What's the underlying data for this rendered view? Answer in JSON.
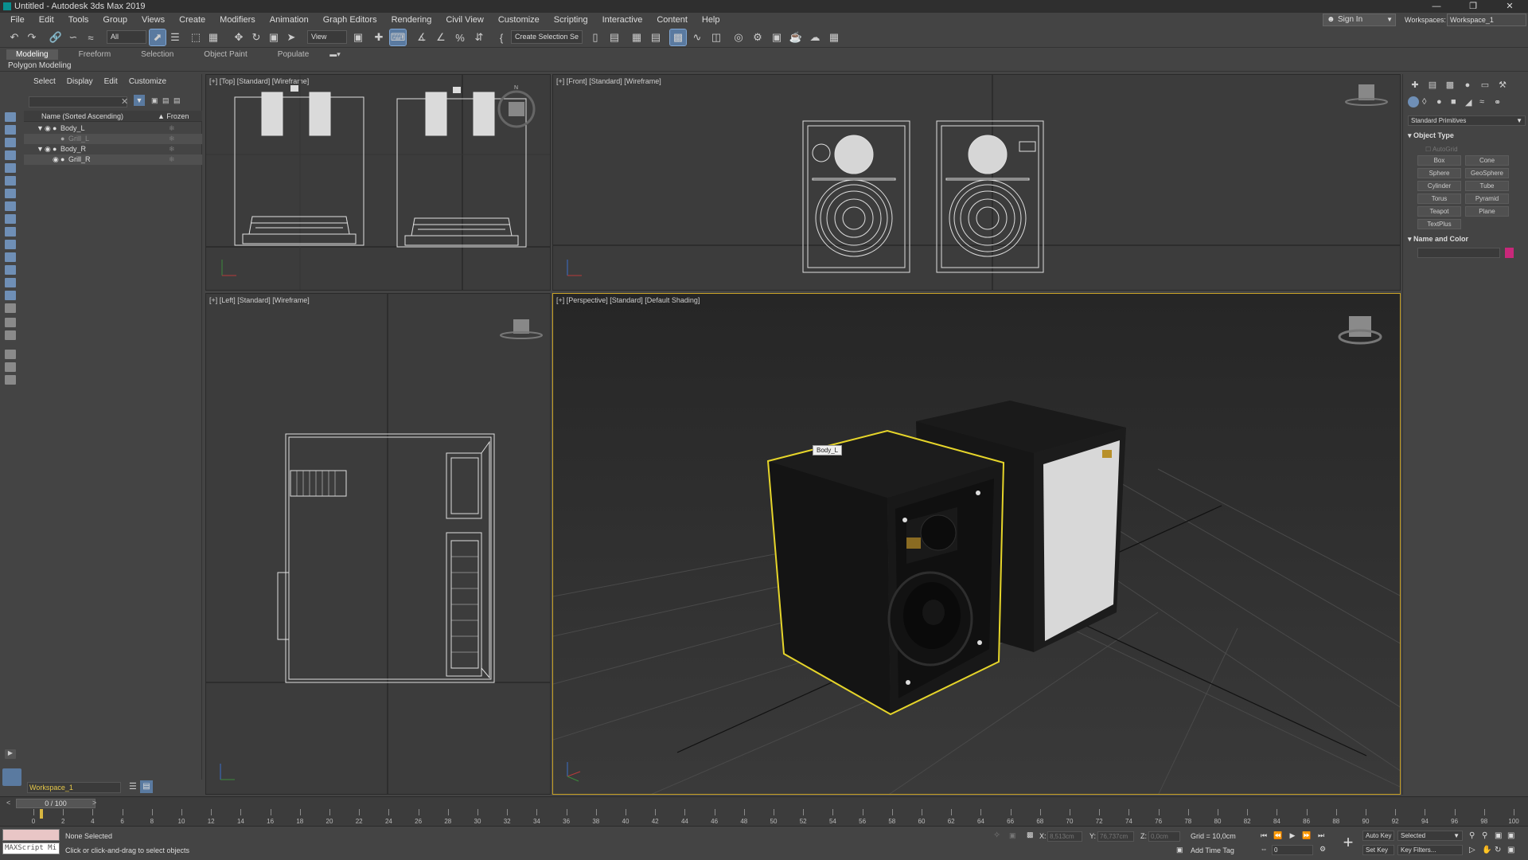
{
  "window": {
    "title": "Untitled - Autodesk 3ds Max 2019"
  },
  "menu": [
    "File",
    "Edit",
    "Tools",
    "Group",
    "Views",
    "Create",
    "Modifiers",
    "Animation",
    "Graph Editors",
    "Rendering",
    "Civil View",
    "Customize",
    "Scripting",
    "Interactive",
    "Content",
    "Help"
  ],
  "account": {
    "sign_in": "Sign In",
    "workspaces_label": "Workspaces:",
    "workspace": "Workspace_1"
  },
  "toolbar": {
    "filter": "All",
    "ref_coord": "View",
    "named_selection": "Create Selection Se"
  },
  "ribbon": {
    "tabs": [
      "Modeling",
      "Freeform",
      "Selection",
      "Object Paint",
      "Populate"
    ],
    "active": "Modeling",
    "panel": "Polygon Modeling"
  },
  "explorer": {
    "menu": [
      "Select",
      "Display",
      "Edit",
      "Customize"
    ],
    "column_name": "Name (Sorted Ascending)",
    "column_frozen": "Frozen",
    "items": [
      {
        "name": "Body_L",
        "level": 0
      },
      {
        "name": "Grill_L",
        "level": 1
      },
      {
        "name": "Body_R",
        "level": 0
      },
      {
        "name": "Grill_R",
        "level": 1
      }
    ],
    "workspace_field": "Workspace_1"
  },
  "viewports": {
    "top": "[+] [Top] [Standard] [Wireframe]",
    "front": "[+] [Front] [Standard] [Wireframe]",
    "left": "[+] [Left] [Standard] [Wireframe]",
    "perspective": "[+] [Perspective] [Standard] [Default Shading]",
    "tooltip": "Body_L"
  },
  "command_panel": {
    "category": "Standard Primitives",
    "object_type_title": "Object Type",
    "autogrid": "AutoGrid",
    "buttons": [
      "Box",
      "Cone",
      "Sphere",
      "GeoSphere",
      "Cylinder",
      "Tube",
      "Torus",
      "Pyramid",
      "Teapot",
      "Plane",
      "TextPlus"
    ],
    "name_color_title": "Name and Color",
    "color": "#c8287a"
  },
  "timeline": {
    "frame": "0 / 100",
    "ticks": [
      "0",
      "2",
      "4",
      "6",
      "8",
      "10",
      "12",
      "14",
      "16",
      "18",
      "20",
      "22",
      "24",
      "26",
      "28",
      "30",
      "32",
      "34",
      "36",
      "38",
      "40",
      "42",
      "44",
      "46",
      "48",
      "50",
      "52",
      "54",
      "56",
      "58",
      "60",
      "62",
      "64",
      "66",
      "68",
      "70",
      "72",
      "74",
      "76",
      "78",
      "80",
      "82",
      "84",
      "86",
      "88",
      "90",
      "92",
      "94",
      "96",
      "98",
      "100"
    ]
  },
  "status": {
    "maxscript": "MAXScript Mi",
    "selection": "None Selected",
    "prompt": "Click or click-and-drag to select objects",
    "x_label": "X:",
    "x": "8,513cm",
    "y_label": "Y:",
    "y": "76,737cm",
    "z_label": "Z:",
    "z": "0,0cm",
    "grid": "Grid = 10,0cm",
    "add_time_tag": "Add Time Tag",
    "auto_key": "Auto Key",
    "set_key": "Set Key",
    "key_mode": "Selected",
    "key_filters": "Key Filters...",
    "frame_field": "0"
  }
}
